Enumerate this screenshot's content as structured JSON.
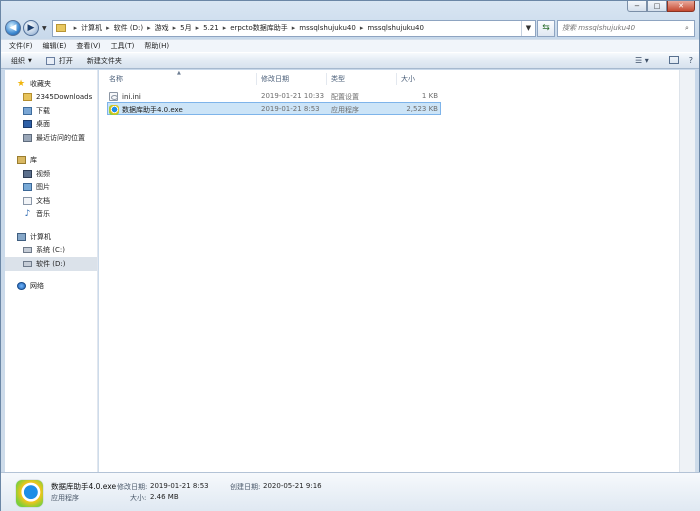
{
  "window": {
    "caption_buttons": [
      "−",
      "□",
      "✕"
    ]
  },
  "address": {
    "crumbs": [
      "计算机",
      "软件 (D:)",
      "游戏",
      "5月",
      "5.21",
      "erpcto数据库助手",
      "mssqlshujuku40",
      "mssqlshujuku40"
    ],
    "search_placeholder": "搜索 mssqlshujuku40"
  },
  "menu": {
    "items": [
      "文件(F)",
      "编辑(E)",
      "查看(V)",
      "工具(T)",
      "帮助(H)"
    ]
  },
  "toolbar": {
    "organize": "组织",
    "open": "打开",
    "new_folder": "新建文件夹"
  },
  "nav": {
    "favorites": {
      "label": "收藏夹",
      "items": [
        "2345Downloads",
        "下载",
        "桌面",
        "最近访问的位置"
      ]
    },
    "libraries": {
      "label": "库",
      "items": [
        "视频",
        "图片",
        "文档",
        "音乐"
      ]
    },
    "computer": {
      "label": "计算机",
      "items": [
        "系统 (C:)",
        "软件 (D:)"
      ]
    },
    "network": {
      "label": "网络"
    }
  },
  "columns": {
    "name": "名称",
    "modified": "修改日期",
    "type": "类型",
    "size": "大小"
  },
  "files": [
    {
      "name": "ini.ini",
      "modified": "2019-01-21 10:33",
      "type": "配置设置",
      "size": "1 KB",
      "icon": "ini-file-icon"
    },
    {
      "name": "数据库助手4.0.exe",
      "modified": "2019-01-21 8:53",
      "type": "应用程序",
      "size": "2,523 KB",
      "icon": "exe-app-icon"
    }
  ],
  "details": {
    "name": "数据库助手4.0.exe",
    "type": "应用程序",
    "modified_label": "修改日期:",
    "modified": "2019-01-21 8:53",
    "created_label": "创建日期:",
    "created": "2020-05-21 9:16",
    "size_label": "大小:",
    "size": "2.46 MB"
  }
}
